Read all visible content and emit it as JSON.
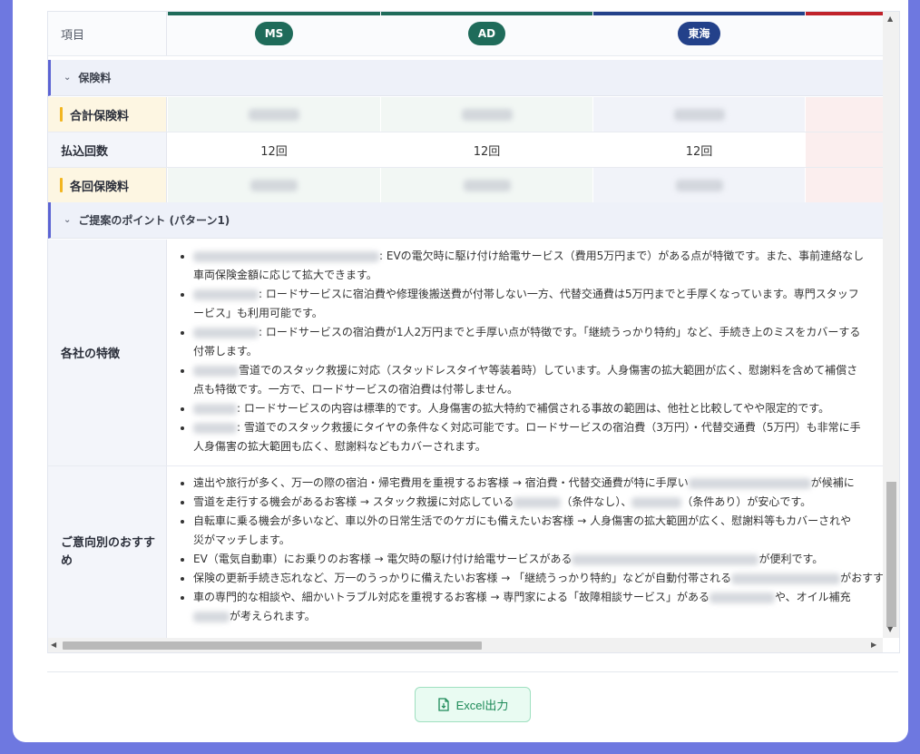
{
  "table": {
    "header_label": "項目",
    "insurers": [
      {
        "short": "MS",
        "color": "#1f6b5a",
        "bar": "#1f6b5a"
      },
      {
        "short": "AD",
        "color": "#1f6b5a",
        "bar": "#1f6b5a"
      },
      {
        "short": "東海",
        "color": "#23418a",
        "bar": "#23418a"
      },
      {
        "short": "",
        "color": "#c0222b",
        "bar": "#c0222b"
      }
    ],
    "premium_section": "保険料",
    "rows": {
      "total_premium": "合計保険料",
      "payment_count": "払込回数",
      "payment_values": [
        "12回",
        "12回",
        "12回"
      ],
      "installment_premium": "各回保険料"
    },
    "points_section": "ご提案のポイント (パターン1)",
    "features_label": "各社の特徴",
    "features": [
      ": EVの電欠時に駆け付け給電サービス（費用5万円まで）がある点が特徴です。また、事前連絡なし",
      "車両保険金額に応じて拡大できます。",
      ": ロードサービスに宿泊費や修理後搬送費が付帯しない一方、代替交通費は5万円までと手厚くなっています。専門スタッフ",
      "ービス」も利用可能です。",
      ": ロードサービスの宿泊費が1人2万円までと手厚い点が特徴です。「継続うっかり特約」など、手続き上のミスをカバーする",
      "付帯します。",
      "雪道でのスタック救援に対応（スタッドレスタイヤ等装着時）しています。人身傷害の拡大範囲が広く、慰謝料を含めて補償さ",
      "点も特徴です。一方で、ロードサービスの宿泊費は付帯しません。",
      ": ロードサービスの内容は標準的です。人身傷害の拡大特約で補償される事故の範囲は、他社と比較してやや限定的です。",
      ": 雪道でのスタック救援にタイヤの条件なく対応可能です。ロードサービスの宿泊費（3万円）・代替交通費（5万円）も非常に手",
      "人身傷害の拡大範囲も広く、慰謝料などもカバーされます。"
    ],
    "recommend_label": "ご意向別のおすすめ",
    "recommend": [
      "遠出や旅行が多く、万一の際の宿泊・帰宅費用を重視するお客様 → 宿泊費・代替交通費が特に手厚い",
      "が候補に",
      "雪道を走行する機会があるお客様 → スタック救援に対応している",
      "（条件なし）、",
      "（条件あり）が安心です。",
      "自転車に乗る機会が多いなど、車以外の日常生活でのケガにも備えたいお客様 → 人身傷害の拡大範囲が広く、慰謝料等もカバーされや",
      "災がマッチします。",
      "EV（電気自動車）にお乗りのお客様 → 電欠時の駆け付け給電サービスがある",
      "が便利です。",
      "保険の更新手続き忘れなど、万一のうっかりに備えたいお客様 → 「継続うっかり特約」などが自動付帯される",
      "がおすすめ",
      "車の専門的な相談や、細かいトラブル対応を重視するお客様 → 専門家による「故障相談サービス」がある",
      "や、オイル補充",
      "が考えられます。"
    ]
  },
  "footer": {
    "excel_label": "Excel出力"
  }
}
